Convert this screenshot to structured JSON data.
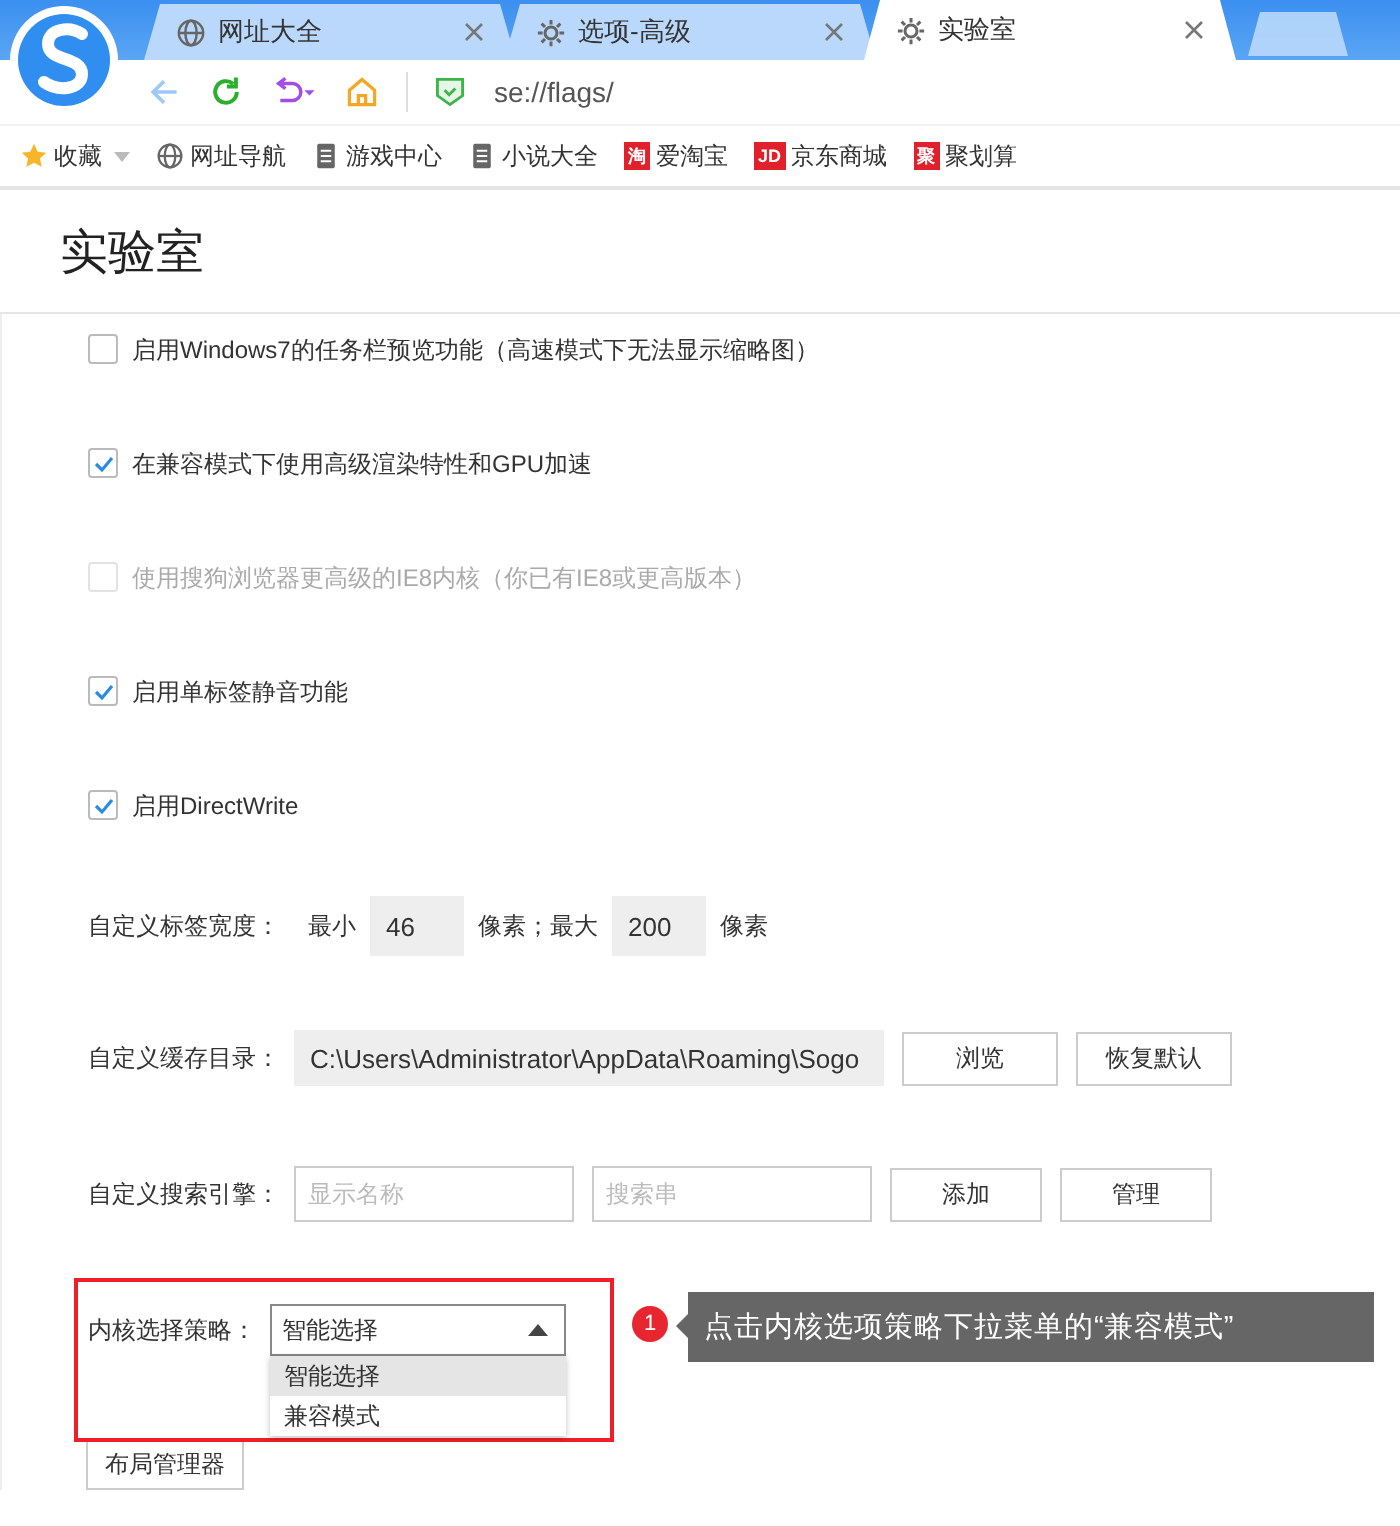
{
  "tabs": [
    {
      "label": "网址大全",
      "kind": "globe",
      "selected": false
    },
    {
      "label": "选项-高级",
      "kind": "gear",
      "selected": false
    },
    {
      "label": "实验室",
      "kind": "gear",
      "selected": true
    }
  ],
  "address": {
    "url": "se://flags/"
  },
  "bookmarks": [
    {
      "label": "收藏",
      "kind": "star"
    },
    {
      "label": "网址导航",
      "kind": "globe"
    },
    {
      "label": "游戏中心",
      "kind": "doc"
    },
    {
      "label": "小说大全",
      "kind": "doc"
    },
    {
      "label": "爱淘宝",
      "kind": "badge",
      "badge": "淘"
    },
    {
      "label": "京东商城",
      "kind": "badge",
      "badge": "JD"
    },
    {
      "label": "聚划算",
      "kind": "badge",
      "badge": "聚"
    }
  ],
  "page_title": "实验室",
  "options": [
    {
      "label": "启用Windows7的任务栏预览功能（高速模式下无法显示缩略图）",
      "checked": false,
      "disabled": false
    },
    {
      "label": "在兼容模式下使用高级渲染特性和GPU加速",
      "checked": true,
      "disabled": false
    },
    {
      "label": "使用搜狗浏览器更高级的IE8内核（你已有IE8或更高版本）",
      "checked": false,
      "disabled": true
    },
    {
      "label": "启用单标签静音功能",
      "checked": true,
      "disabled": false
    },
    {
      "label": "启用DirectWrite",
      "checked": true,
      "disabled": false
    }
  ],
  "tab_width": {
    "label": "自定义标签宽度：",
    "min_label": "最小",
    "min": "46",
    "mid_label": "像素；最大",
    "max": "200",
    "unit": "像素"
  },
  "cache_dir": {
    "label": "自定义缓存目录：",
    "value": "C:\\Users\\Administrator\\AppData\\Roaming\\Sogo",
    "buttons": [
      "浏览",
      "恢复默认"
    ]
  },
  "search_engine": {
    "label": "自定义搜索引擎：",
    "name_placeholder": "显示名称",
    "query_placeholder": "搜索串",
    "buttons": [
      "添加",
      "管理"
    ]
  },
  "kernel": {
    "label": "内核选择策略：",
    "value": "智能选择",
    "expanded": true,
    "options": [
      {
        "label": "智能选择",
        "selected": true
      },
      {
        "label": "兼容模式",
        "selected": false
      }
    ]
  },
  "layout_button": "布局管理器",
  "callout": {
    "number": "1",
    "text": "点击内核选项策略下拉菜单的“兼容模式”"
  }
}
